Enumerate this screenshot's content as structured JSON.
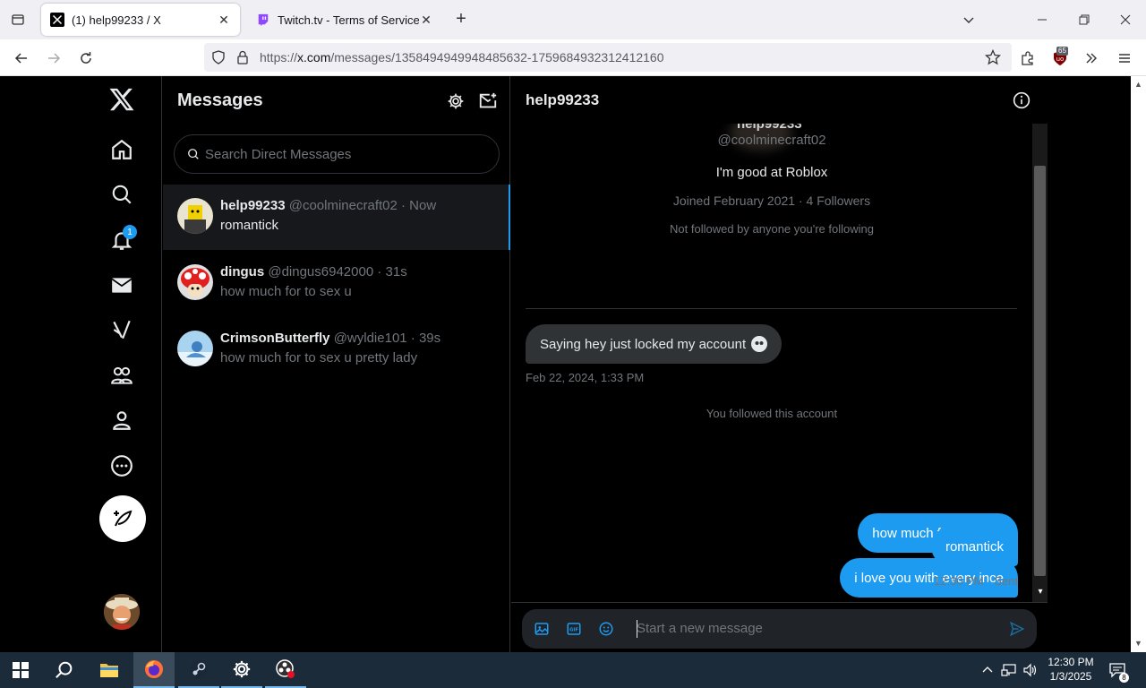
{
  "browser": {
    "tabs": [
      {
        "title": "(1) help99233 / X",
        "active": true
      },
      {
        "title": "Twitch.tv - Terms of Service",
        "active": false
      }
    ],
    "url_prefix": "https://",
    "url_host": "x.com",
    "url_path": "/messages/1358494949948485632-1759684932312412160",
    "extension_badge": "65"
  },
  "sidebar": {
    "notification_count": "1"
  },
  "messages_panel": {
    "title": "Messages",
    "search_placeholder": "Search Direct Messages",
    "conversations": [
      {
        "name": "help99233",
        "handle": "@coolminecraft02",
        "time": "· Now",
        "preview": "romantick"
      },
      {
        "name": "dingus",
        "handle": "@dingus6942000",
        "time": "· 31s",
        "preview": "how much for to sex u"
      },
      {
        "name": "CrimsonButterfly",
        "handle": "@wyldie101",
        "time": "· 39s",
        "preview": "how much for to sex u pretty lady"
      }
    ]
  },
  "chat": {
    "title": "help99233",
    "profile": {
      "name_partial": "help99233",
      "handle": "@coolminecraft02",
      "bio": "I'm good at Roblox",
      "joined": "Joined February 2021 · 4 Followers",
      "followed_by": "Not followed by anyone you're following"
    },
    "incoming": {
      "text": "Saying hey just locked my account",
      "timestamp": "Feb 22, 2024, 1:33 PM"
    },
    "system_note": "You followed this account",
    "outgoing": [
      {
        "text": "how much for to sex u"
      },
      {
        "text": "i love you with every ince"
      },
      {
        "text": "romantick"
      }
    ],
    "sent_status": "12:30 PM · Sent",
    "compose_placeholder": "Start a new message"
  },
  "taskbar": {
    "time": "12:30 PM",
    "date": "1/3/2025",
    "notification_count": "8"
  },
  "colors": {
    "accent": "#1d9bf0",
    "background": "#000000",
    "text_primary": "#e7e9ea",
    "text_secondary": "#71767b"
  }
}
